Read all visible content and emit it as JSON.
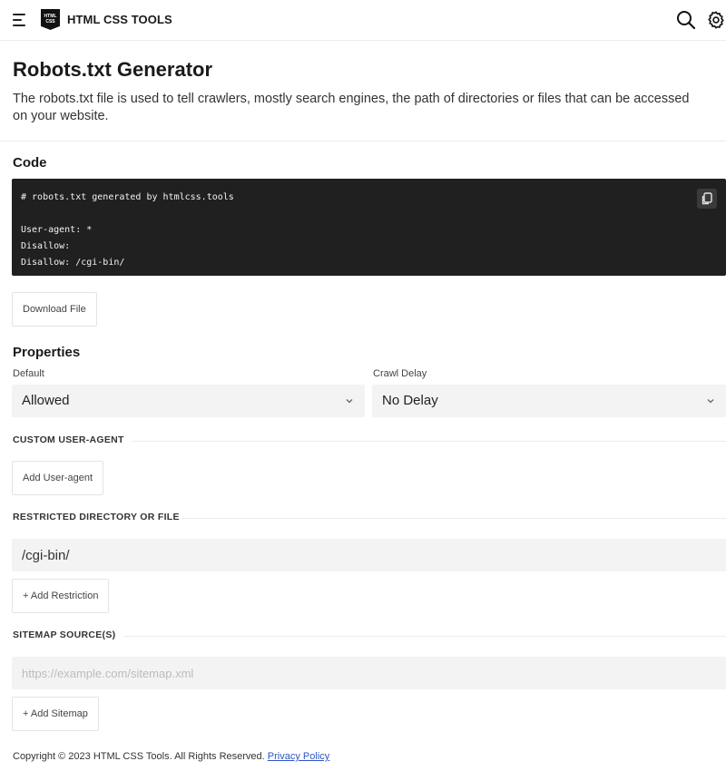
{
  "header": {
    "logo_text_top": "HTML",
    "logo_text_bottom": "CSS",
    "brand": "HTML CSS TOOLS"
  },
  "intro": {
    "title": "Robots.txt Generator",
    "description": "The robots.txt file is used to tell crawlers, mostly search engines, the path of directories or files that can be accessed on your website."
  },
  "code": {
    "section_title": "Code",
    "lines": [
      "# robots.txt generated by htmlcss.tools",
      "",
      "User-agent: *",
      "Disallow:",
      "Disallow: /cgi-bin/"
    ],
    "download_label": "Download File"
  },
  "properties": {
    "section_title": "Properties",
    "default_label": "Default",
    "default_value": "Allowed",
    "crawl_delay_label": "Crawl Delay",
    "crawl_delay_value": "No Delay"
  },
  "custom_user_agent": {
    "title": "CUSTOM USER-AGENT",
    "add_label": "Add User-agent"
  },
  "restricted": {
    "title": "RESTRICTED DIRECTORY OR FILE",
    "value": "/cgi-bin/",
    "add_label": "+ Add Restriction"
  },
  "sitemap": {
    "title": "SITEMAP SOURCE(S)",
    "placeholder": "https://example.com/sitemap.xml",
    "add_label": "+ Add Sitemap"
  },
  "footer": {
    "copyright": "Copyright © 2023 HTML CSS Tools. All Rights Reserved.",
    "privacy_label": "Privacy Policy"
  }
}
